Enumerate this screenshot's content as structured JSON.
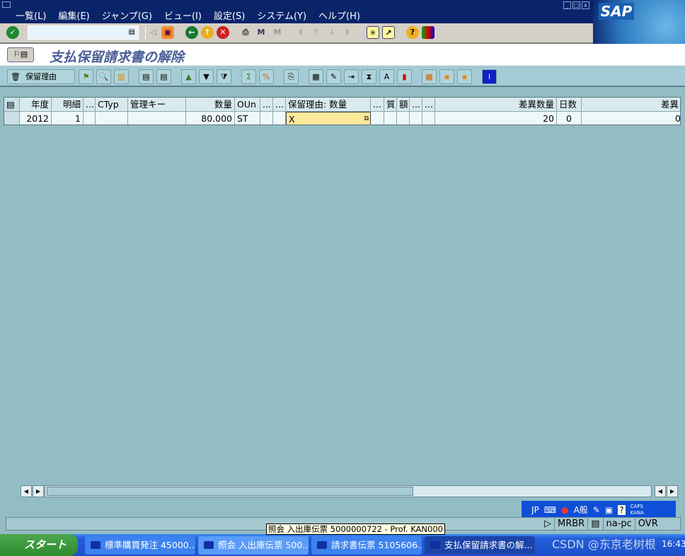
{
  "menu": [
    "一覧(L)",
    "編集(E)",
    "ジャンプ(G)",
    "ビュー(I)",
    "設定(S)",
    "システム(Y)",
    "ヘルプ(H)"
  ],
  "logo": "SAP",
  "command_field": {
    "value": ""
  },
  "page_title": "支払保留請求書の解除",
  "app_toolbar": {
    "hold_reason_label": "保留理由"
  },
  "grid": {
    "headers": [
      "年度",
      "明細",
      "...",
      "CTyp",
      "管理キー",
      "数量",
      "OUn",
      "...",
      "...",
      "保留理由: 数量",
      "...",
      "質",
      "額",
      "...",
      "...",
      "差異数量",
      "日数",
      "差異"
    ],
    "rows": [
      [
        "2012",
        "1",
        "",
        "",
        "",
        "80.000",
        "ST",
        "",
        "",
        "X",
        "",
        "",
        "",
        "",
        "",
        "20",
        "0",
        "0"
      ]
    ]
  },
  "status_bar": {
    "fields": [
      "MRBR",
      "na-pc",
      "OVR"
    ]
  },
  "tooltip": "照会 入出庫伝票 5000000722 - Prof. KAN000",
  "ime": {
    "lang": "JP",
    "mode": "A般",
    "caps": "CAPS",
    "kana": "KANA"
  },
  "taskbar": {
    "start": "スタート",
    "tasks": [
      "標準購買発注 45000...",
      "照会 入出庫伝票 500...",
      "請求書伝票 5105606...",
      "支払保留請求書の解..."
    ],
    "clock": "16:43"
  },
  "watermark": "CSDN @东京老树根"
}
